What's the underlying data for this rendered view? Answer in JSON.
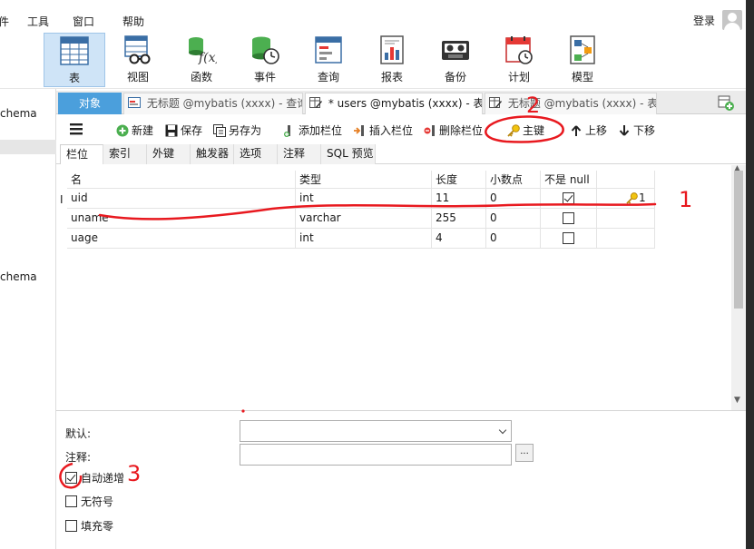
{
  "menu": {
    "partial_left": "件",
    "items": [
      "工具",
      "窗口",
      "帮助"
    ],
    "login": "登录"
  },
  "toolbar": {
    "items": [
      {
        "label": "表",
        "icon": "table-icon",
        "active": true
      },
      {
        "label": "视图",
        "icon": "view-icon"
      },
      {
        "label": "函数",
        "icon": "function-icon"
      },
      {
        "label": "事件",
        "icon": "event-icon"
      },
      {
        "label": "查询",
        "icon": "query-icon"
      },
      {
        "label": "报表",
        "icon": "report-icon"
      },
      {
        "label": "备份",
        "icon": "backup-icon"
      },
      {
        "label": "计划",
        "icon": "schedule-icon"
      },
      {
        "label": "模型",
        "icon": "model-icon"
      }
    ]
  },
  "sidebar": {
    "items": [
      "chema",
      "chema"
    ]
  },
  "object_tabs": [
    {
      "label": "对象",
      "type": "object"
    },
    {
      "label": "无标题 @mybatis (xxxx) - 查询",
      "type": "query"
    },
    {
      "label": "* users @mybatis (xxxx) - 表",
      "type": "table",
      "current": true
    },
    {
      "label": "无标题 @mybatis (xxxx) - 表",
      "type": "table"
    }
  ],
  "editor_toolbar": {
    "new": "新建",
    "save": "保存",
    "save_as": "另存为",
    "add_column": "添加栏位",
    "insert_column": "插入栏位",
    "delete_column": "删除栏位",
    "primary_key": "主键",
    "move_up": "上移",
    "move_down": "下移"
  },
  "sub_tabs": [
    "栏位",
    "索引",
    "外键",
    "触发器",
    "选项",
    "注释",
    "SQL 预览"
  ],
  "grid": {
    "row_marker": "I",
    "headers": [
      "名",
      "类型",
      "长度",
      "小数点",
      "不是 null"
    ],
    "rows": [
      {
        "name": "uid",
        "type": "int",
        "length": "11",
        "decimals": "0",
        "not_null": true,
        "key": "1"
      },
      {
        "name": "uname",
        "type": "varchar",
        "length": "255",
        "decimals": "0",
        "not_null": false,
        "key": ""
      },
      {
        "name": "uage",
        "type": "int",
        "length": "4",
        "decimals": "0",
        "not_null": false,
        "key": ""
      }
    ]
  },
  "properties": {
    "default_label": "默认:",
    "default_value": "",
    "comment_label": "注释:",
    "comment_value": "",
    "browse_button": "...",
    "checks": [
      {
        "label": "自动递增",
        "checked": true
      },
      {
        "label": "无符号",
        "checked": false
      },
      {
        "label": "填充零",
        "checked": false
      }
    ]
  },
  "annotations": [
    "1",
    "2",
    "3"
  ],
  "colors": {
    "accent": "#4b9fdc",
    "active_tool": "#cfe4f7",
    "annotation": "#e8191f"
  }
}
